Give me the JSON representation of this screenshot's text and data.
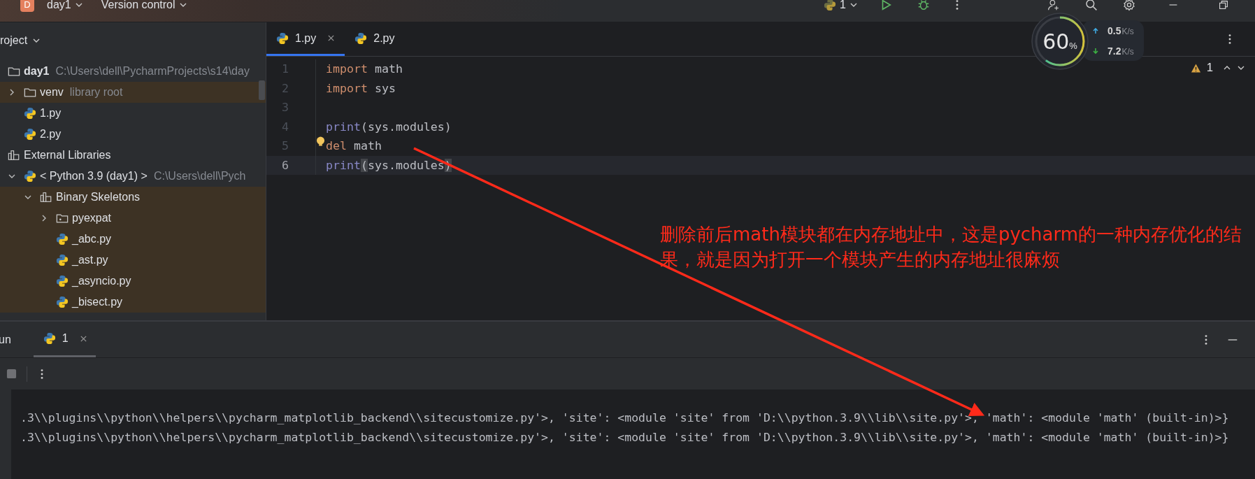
{
  "title_bar": {
    "project_badge": "D",
    "project_name": "day1",
    "vcs_menu": "Version control",
    "run_configuration": "1"
  },
  "project_panel": {
    "title": "roject",
    "tree": [
      {
        "name": "day1",
        "hint": "C:\\Users\\dell\\PycharmProjects\\s14\\day",
        "kind": "folder",
        "highlighted": false,
        "children": [
          {
            "name": "venv",
            "hint": "library root",
            "kind": "folder",
            "expanded": false,
            "highlighted": true
          },
          {
            "name": "1.py",
            "kind": "python",
            "highlighted": false
          },
          {
            "name": "2.py",
            "kind": "python",
            "highlighted": false
          }
        ]
      },
      {
        "name": "External Libraries",
        "kind": "library",
        "highlighted": false,
        "children": [
          {
            "name": "< Python 3.9 (day1) >",
            "hint": "C:\\Users\\dell\\Pych",
            "kind": "python",
            "expanded": true,
            "highlighted": false,
            "children": [
              {
                "name": "Binary Skeletons",
                "kind": "library",
                "expanded": true,
                "highlighted": true,
                "children": [
                  {
                    "name": "pyexpat",
                    "kind": "package",
                    "expanded": false,
                    "highlighted": true
                  },
                  {
                    "name": "_abc.py",
                    "kind": "python",
                    "highlighted": true
                  },
                  {
                    "name": "_ast.py",
                    "kind": "python",
                    "highlighted": true
                  },
                  {
                    "name": "_asyncio.py",
                    "kind": "python",
                    "highlighted": true
                  },
                  {
                    "name": "_bisect.py",
                    "kind": "python",
                    "highlighted": true
                  }
                ]
              }
            ]
          }
        ]
      }
    ]
  },
  "editor": {
    "tabs": [
      {
        "label": "1.py",
        "selected": true,
        "closable": true
      },
      {
        "label": "2.py",
        "selected": false,
        "closable": false
      }
    ],
    "warning_count": "1",
    "lines": [
      {
        "number": "1",
        "current": false,
        "bulb": false,
        "tokens": [
          {
            "text": "import",
            "kind": "keyword"
          },
          {
            "text": " math",
            "kind": "plain"
          }
        ]
      },
      {
        "number": "2",
        "current": false,
        "bulb": false,
        "tokens": [
          {
            "text": "import",
            "kind": "keyword"
          },
          {
            "text": " sys",
            "kind": "plain"
          }
        ]
      },
      {
        "number": "3",
        "current": false,
        "bulb": false
      },
      {
        "number": "4",
        "current": false,
        "bulb": false,
        "tokens": [
          {
            "text": "print",
            "kind": "builtin"
          },
          {
            "text": "(sys.modules)",
            "kind": "plain"
          }
        ]
      },
      {
        "number": "5",
        "current": false,
        "bulb": true,
        "tokens": [
          {
            "text": "del",
            "kind": "keyword"
          },
          {
            "text": " math",
            "kind": "plain"
          }
        ]
      },
      {
        "number": "6",
        "current": true,
        "bulb": false,
        "tokens": [
          {
            "text": "print",
            "kind": "builtin"
          },
          {
            "text": "(",
            "kind": "bracket-match"
          },
          {
            "text": "sys.modules",
            "kind": "plain"
          },
          {
            "text": ")",
            "kind": "bracket-match"
          }
        ]
      }
    ]
  },
  "run_panel": {
    "title": "un",
    "tabs": [
      {
        "label": "1",
        "selected": true
      }
    ],
    "output": [
      ".3\\\\plugins\\\\python\\\\helpers\\\\pycharm_matplotlib_backend\\\\sitecustomize.py'>, 'site': <module 'site' from 'D:\\\\python.3.9\\\\lib\\\\site.py'>, 'math': <module 'math' (built-in)>}",
      ".3\\\\plugins\\\\python\\\\helpers\\\\pycharm_matplotlib_backend\\\\sitecustomize.py'>, 'site': <module 'site' from 'D:\\\\python.3.9\\\\lib\\\\site.py'>, 'math': <module 'math' (built-in)>}"
    ]
  },
  "monitor": {
    "percent": "60",
    "percent_unit": "%",
    "upload": "0.5",
    "upload_unit": "K/s",
    "download": "7.2",
    "download_unit": "K/s"
  },
  "annotation": {
    "text": "删除前后math模块都在内存地址中，这是pycharm的一种内存优化的结果，就是因为打开一个模块产生的内存地址很麻烦"
  }
}
